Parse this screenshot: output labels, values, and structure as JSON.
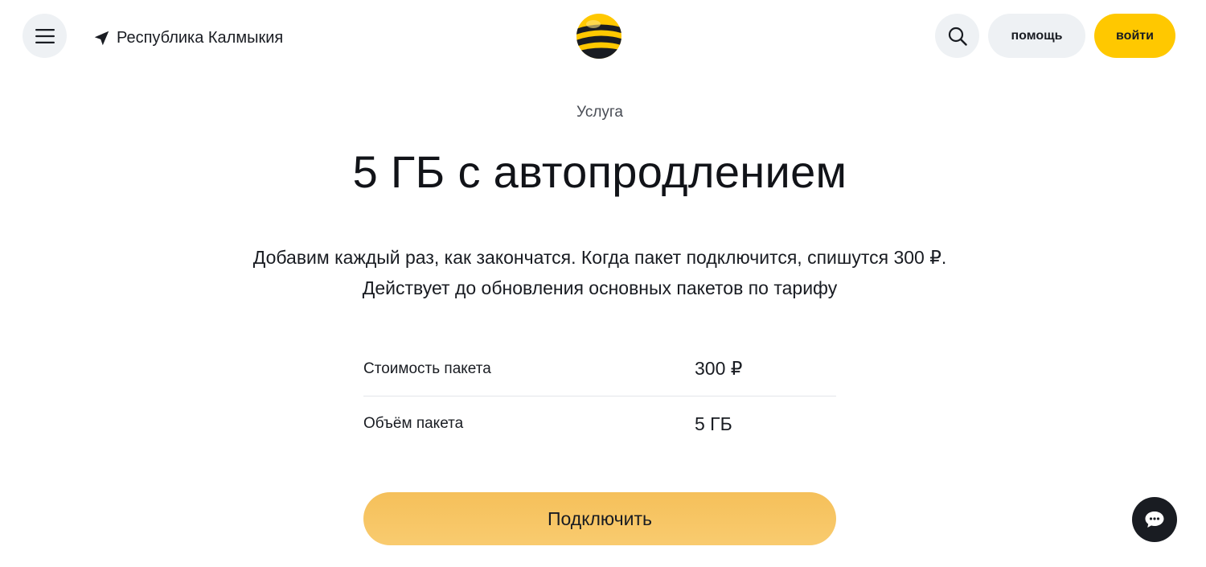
{
  "header": {
    "menu_icon": "hamburger-icon",
    "region_icon": "location-arrow-icon",
    "region": "Республика Калмыкия",
    "logo_icon": "striped-ball-logo",
    "search_icon": "search-icon",
    "help_label": "помощь",
    "login_label": "войти"
  },
  "main": {
    "eyebrow": "Услуга",
    "title": "5 ГБ с автопродлением",
    "description_line1": "Добавим каждый раз, как закончатся. Когда пакет подключится, спишутся 300 ₽.",
    "description_line2": "Действует до обновления основных пакетов по тарифу",
    "params": [
      {
        "label": "Стоимость пакета",
        "value": "300 ₽"
      },
      {
        "label": "Объём пакета",
        "value": "5 ГБ"
      }
    ],
    "connect_label": "Подключить"
  },
  "chat": {
    "icon": "chat-bubble-icon"
  },
  "colors": {
    "accent_yellow": "#ffc800",
    "button_gradient_top": "#f5c05a",
    "button_gradient_bottom": "#f9cb6f",
    "chip_bg": "#eef1f4",
    "text_dark": "#191c22"
  }
}
